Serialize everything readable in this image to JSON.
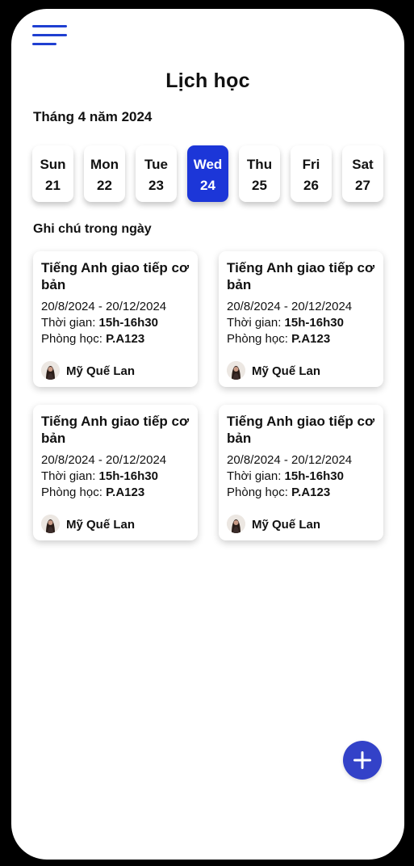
{
  "header": {
    "title": "Lịch học",
    "menu_icon": "hamburger-menu-icon"
  },
  "calendar": {
    "month_label": "Tháng 4 năm 2024",
    "days": [
      {
        "name": "Sun",
        "date": "21",
        "active": false
      },
      {
        "name": "Mon",
        "date": "22",
        "active": false
      },
      {
        "name": "Tue",
        "date": "23",
        "active": false
      },
      {
        "name": "Wed",
        "date": "24",
        "active": true
      },
      {
        "name": "Thu",
        "date": "25",
        "active": false
      },
      {
        "name": "Fri",
        "date": "26",
        "active": false
      },
      {
        "name": "Sat",
        "date": "27",
        "active": false
      }
    ]
  },
  "notes": {
    "label": "Ghi chú trong ngày",
    "cards": [
      {
        "title": "Tiếng Anh giao tiếp cơ bản",
        "dates": "20/8/2024 - 20/12/2024",
        "time_label": "Thời gian:",
        "time": "15h-16h30",
        "room_label": "Phòng học:",
        "room": "P.A123",
        "teacher": "Mỹ Quế Lan"
      },
      {
        "title": "Tiếng Anh giao tiếp cơ bản",
        "dates": "20/8/2024 - 20/12/2024",
        "time_label": "Thời gian:",
        "time": "15h-16h30",
        "room_label": "Phòng học:",
        "room": "P.A123",
        "teacher": "Mỹ Quế Lan"
      },
      {
        "title": "Tiếng Anh giao tiếp cơ bản",
        "dates": "20/8/2024 - 20/12/2024",
        "time_label": "Thời gian:",
        "time": "15h-16h30",
        "room_label": "Phòng học:",
        "room": "P.A123",
        "teacher": "Mỹ Quế Lan"
      },
      {
        "title": "Tiếng Anh giao tiếp cơ bản",
        "dates": "20/8/2024 - 20/12/2024",
        "time_label": "Thời gian:",
        "time": "15h-16h30",
        "room_label": "Phòng học:",
        "room": "P.A123",
        "teacher": "Mỹ Quế Lan"
      }
    ]
  },
  "fab": {
    "icon": "plus-icon"
  },
  "colors": {
    "accent": "#1c36d8",
    "fab": "#3342c8",
    "menu": "#1f3fd1",
    "frame": "#000000"
  }
}
